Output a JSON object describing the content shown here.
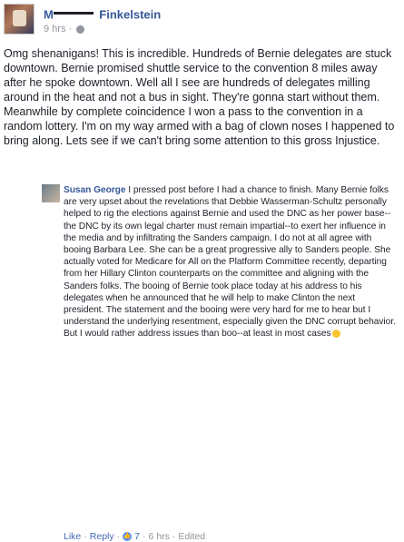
{
  "post": {
    "author_first_initial": "M",
    "author_last": "Finkelstein",
    "timestamp": "9 hrs",
    "text": "Omg shenanigans! This is incredible. Hundreds of Bernie delegates are stuck downtown. Bernie promised shuttle service to the convention 8 miles away after he spoke downtown. Well all I see are hundreds of delegates milling around in the heat and not a bus in sight. They're gonna start without them. Meanwhile by complete coincidence I won a pass to the convention in a random lottery. I'm on my way armed with a bag of clown noses I happened to bring along. Lets see if we can't bring some attention to this gross Injustice."
  },
  "reply": {
    "author": "Susan George",
    "text": "I pressed post before I had a chance to finish. Many Bernie folks are very upset about the revelations that Debbie Wasserman-Schultz personally helped to rig the elections against Bernie and used the DNC as her power base--the DNC by its own legal charter must remain impartial--to exert her influence in the media and by infiltrating the Sanders campaign. I do not at all agree with booing Barbara Lee. She can be a great progressive ally to Sanders people. She actually voted for Medicare for All on the Platform Committee recently, departing from her Hillary Clinton counterparts on the committee and aligning with the Sanders folks. The booing of Bernie took place today at his address to his delegates when he announced that he will help to make Clinton the next president. The statement and the booing were very hard for me to hear but I understand the underlying resentment, especially given the DNC corrupt behavior. But I would rather address issues than boo--at least in most cases",
    "actions": {
      "like": "Like",
      "sep1": "·",
      "reply": "Reply",
      "sep2": "·",
      "like_count": "7",
      "sep3": "·",
      "time": "6 hrs",
      "sep4": "·",
      "edited": "Edited"
    }
  },
  "colors": {
    "name_link": "#365899",
    "meta": "#90949c",
    "text": "#1d2129"
  }
}
